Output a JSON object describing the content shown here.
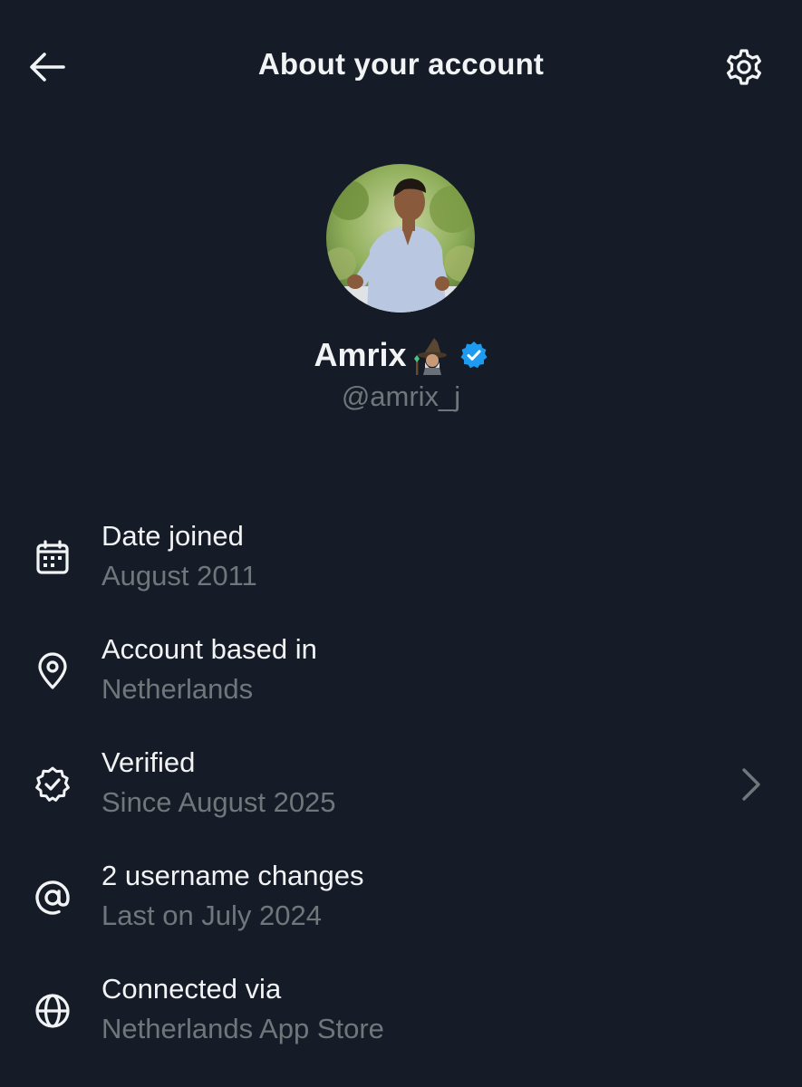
{
  "header": {
    "title": "About your account",
    "back_icon": "arrow-left-icon",
    "settings_icon": "gear-icon"
  },
  "profile": {
    "name": "Amrix",
    "emoji": "mage-emoji",
    "handle": "@amrix_j",
    "verified_color": "#1d9bf0"
  },
  "info": [
    {
      "icon": "calendar-icon",
      "title": "Date joined",
      "subtitle": "August 2011"
    },
    {
      "icon": "location-pin-icon",
      "title": "Account based in",
      "subtitle": "Netherlands"
    },
    {
      "icon": "verified-check-icon",
      "title": "Verified",
      "subtitle": "Since August 2025",
      "has_chevron": true
    },
    {
      "icon": "at-sign-icon",
      "title": "2 username changes",
      "subtitle": "Last on July 2024"
    },
    {
      "icon": "globe-icon",
      "title": "Connected via",
      "subtitle": "Netherlands App Store"
    }
  ],
  "colors": {
    "background": "#151c27",
    "primary_text": "#f2f3f5",
    "secondary_text": "#71767b",
    "accent": "#1d9bf0"
  }
}
